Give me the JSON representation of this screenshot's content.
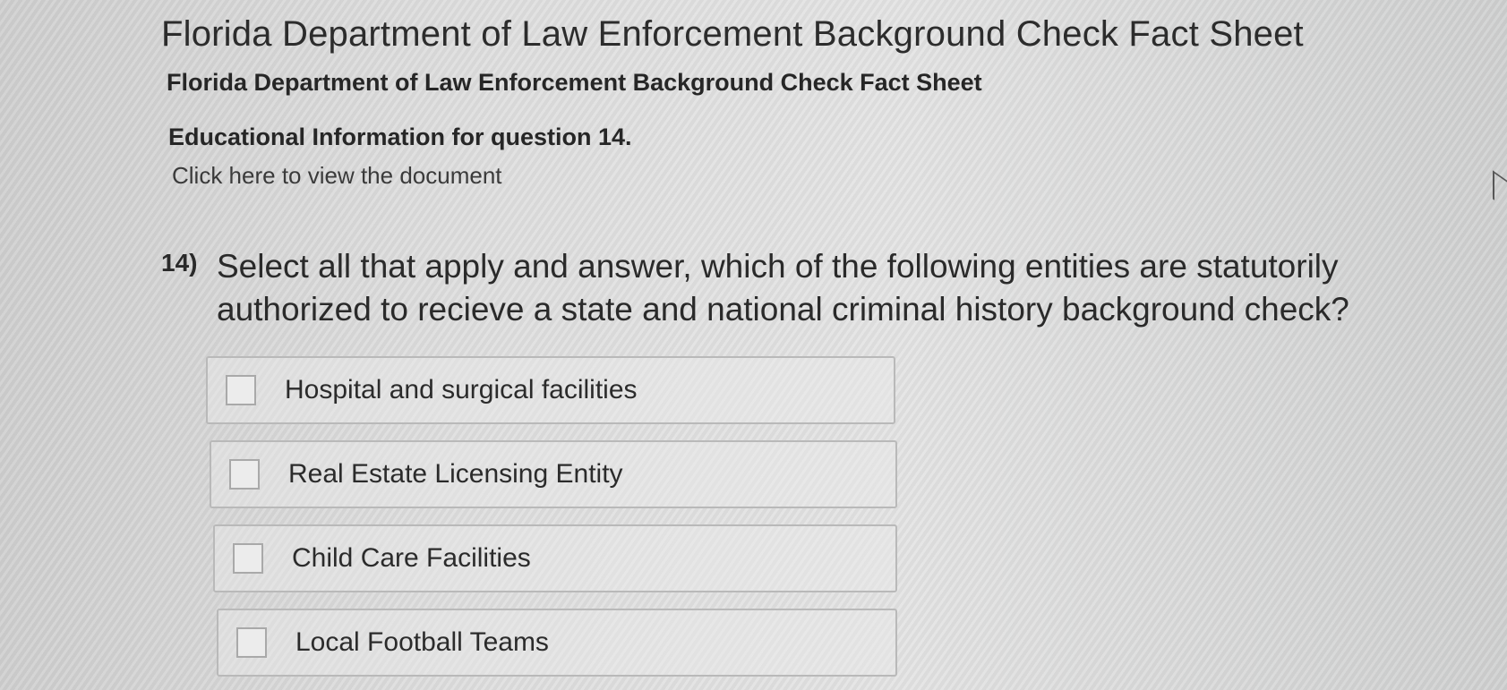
{
  "page": {
    "title": "Florida Department of Law Enforcement Background Check Fact Sheet",
    "document_title": "Florida Department of Law Enforcement Background Check Fact Sheet",
    "info_label": "Educational Information for question 14.",
    "document_link": "Click here to view the document"
  },
  "question": {
    "number": "14)",
    "text": "Select all that apply and answer, which of the following entities are statutorily authorized to recieve a state and national criminal history background check?",
    "options": [
      {
        "label": "Hospital and surgical facilities",
        "checked": false
      },
      {
        "label": "Real Estate Licensing Entity",
        "checked": false
      },
      {
        "label": "Child Care Facilities",
        "checked": false
      },
      {
        "label": "Local Football Teams",
        "checked": false
      }
    ]
  }
}
